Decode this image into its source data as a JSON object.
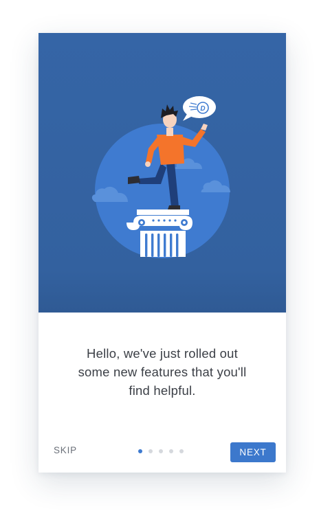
{
  "onboarding": {
    "message": "Hello, we've just rolled out\nsome new features that you'll\nfind helpful.",
    "skip_label": "SKIP",
    "next_label": "NEXT",
    "pagination": {
      "total": 5,
      "current": 1
    },
    "illustration": {
      "speech_bubble_letter": "D",
      "icons": [
        "person-on-pillar-illustration",
        "speech-bubble-icon",
        "cloud-icon",
        "ionic-column-icon"
      ]
    }
  },
  "colors": {
    "hero_background": "#3565a6",
    "circle": "#3f7bd0",
    "accent_button": "#3c78cc",
    "shirt": "#f4742b",
    "active_dot": "#3f7bd0",
    "inactive_dot": "#d5d8dd"
  }
}
